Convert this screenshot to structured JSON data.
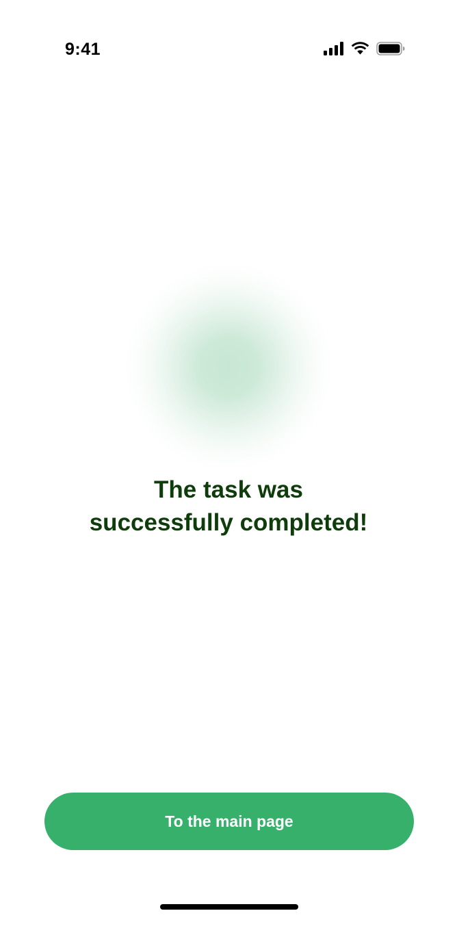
{
  "status_bar": {
    "time": "9:41",
    "icons": [
      "cellular-signal-icon",
      "wifi-icon",
      "battery-icon"
    ]
  },
  "message": {
    "line1": "The task was",
    "line2": "successfully completed!"
  },
  "button": {
    "label": "To the main page"
  },
  "colors": {
    "accent": "#37b06b",
    "message_text": "#0e3d0b",
    "glow": "#6cbe8c"
  }
}
